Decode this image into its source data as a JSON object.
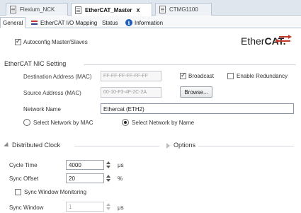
{
  "editor_tabs": [
    {
      "label": "Flexium_NCK"
    },
    {
      "label": "EtherCAT_Master",
      "close": "x"
    },
    {
      "label": "CTMG1100"
    }
  ],
  "sub_tabs": [
    "General",
    "EtherCAT I/O Mapping",
    "Status",
    "Information"
  ],
  "autoconfig": {
    "label": "Autoconfig Master/Slaves",
    "checked": true
  },
  "logo": {
    "ether": "Ether",
    "cat": "CAT."
  },
  "nic": {
    "title": "EtherCAT NIC Setting",
    "dest_label": "Destination Address (MAC)",
    "dest_value": "FF-FF-FF-FF-FF-FF",
    "broadcast_label": "Broadcast",
    "redundancy_label": "Enable Redundancy",
    "source_label": "Source Address (MAC)",
    "source_value": "00-10-F3-4F-2C-2A",
    "browse_label": "Browse...",
    "network_name_label": "Network Name",
    "network_name_value": "Ethercat (ETH2)",
    "radio_mac_label": "Select Network by MAC",
    "radio_name_label": "Select Network by Name"
  },
  "dc": {
    "title": "Distributed Clock",
    "options_label": "Options",
    "cycle_label": "Cycle Time",
    "cycle_value": "4000",
    "cycle_unit": "μs",
    "offset_label": "Sync Offset",
    "offset_value": "20",
    "offset_unit": "%",
    "monitoring_label": "Sync Window Monitoring",
    "window_label": "Sync Window",
    "window_value": "1",
    "window_unit": "μs"
  },
  "colors": {
    "accent": "#c0392b",
    "tab_border": "#b8c4d2"
  }
}
